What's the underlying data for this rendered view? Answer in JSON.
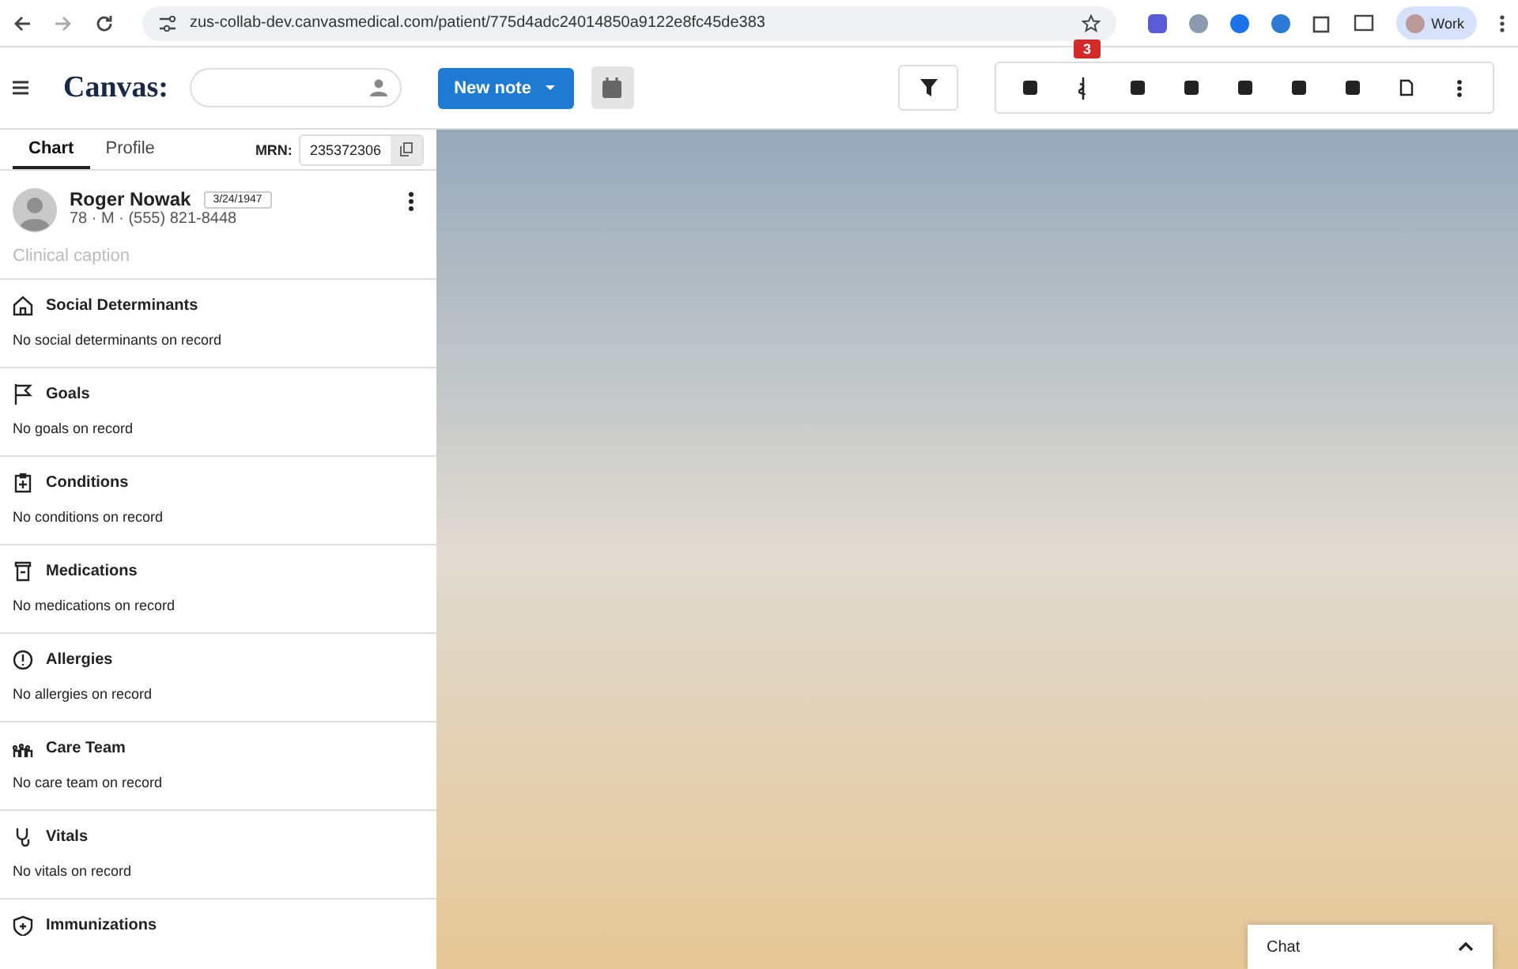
{
  "browser": {
    "url": "zus-collab-dev.canvasmedical.com/patient/775d4adc24014850a9122e8fc45de383",
    "profile": "Work"
  },
  "header": {
    "logo": "Canvas",
    "logo_mark": ":",
    "new_note": "New note",
    "notification_badge": "3"
  },
  "tabs": [
    {
      "label": "Chart",
      "selected": true
    },
    {
      "label": "Profile",
      "selected": false
    }
  ],
  "mrn": {
    "label": "MRN:",
    "value": "235372306"
  },
  "patient": {
    "name": "Roger Nowak",
    "dob": "3/24/1947",
    "details": "78 · M · (555) 821-8448",
    "caption_placeholder": "Clinical caption"
  },
  "sections": [
    {
      "title": "Social Determinants",
      "empty": "No social determinants on record"
    },
    {
      "title": "Goals",
      "empty": "No goals on record"
    },
    {
      "title": "Conditions",
      "empty": "No conditions on record"
    },
    {
      "title": "Medications",
      "empty": "No medications on record"
    },
    {
      "title": "Allergies",
      "empty": "No allergies on record"
    },
    {
      "title": "Care Team",
      "empty": "No care team on record"
    },
    {
      "title": "Vitals",
      "empty": "No vitals on record"
    },
    {
      "title": "Immunizations"
    }
  ],
  "chat": {
    "label": "Chat",
    "expanded": false
  }
}
